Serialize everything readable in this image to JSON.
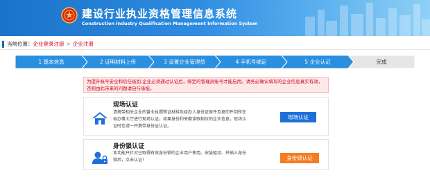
{
  "header": {
    "title_cn": "建设行业执业资格管理信息系统",
    "title_en": "Construction Industry Qualification Management Information System"
  },
  "breadcrumb": {
    "label": "当前位置：",
    "items": [
      "企业登录注册",
      "企业注册"
    ],
    "separator": ">"
  },
  "steps": [
    {
      "label": "1 基本信息",
      "state": "done"
    },
    {
      "label": "2 证明材料上传",
      "state": "done"
    },
    {
      "label": "3 设置企业管理员",
      "state": "done"
    },
    {
      "label": "4 手机号绑定",
      "state": "done"
    },
    {
      "label": "5 企业认证",
      "state": "active"
    },
    {
      "label": "完成",
      "state": "pending"
    }
  ],
  "notice": "为提升账号安全和信任级别,企业必须通过认证后，绑定的管理员账号才能启用。请务必确认填写的企业信息真实有效，否则由此带来的问题请自行承担。",
  "cards": [
    {
      "title": "现场认证",
      "desc": "请携带相关企业的营业执照等证材料及经办人身份证原件及复印件到所在省办事大厅进行现场认证。如果身份和来都读取相应的企业信息，现场认证时也请一并携带身份证认证。",
      "button": "现场认证",
      "icon": "house-icon"
    },
    {
      "title": "身份锁认证",
      "desc": "本功能只针对已取得有效身份锁的企业用户使用。安装驱动、并插入身份锁后，点击认证！",
      "button": "身份锁认证",
      "icon": "user-lock-icon"
    }
  ],
  "colors": {
    "header_blue": "#1a73c8",
    "step_done": "#2b8fe0",
    "step_active": "#2b8fe0",
    "step_pending": "#e6e6e6",
    "accent_red": "#d0021b",
    "button_blue": "#1e6fd9",
    "button_orange": "#f57c22"
  }
}
